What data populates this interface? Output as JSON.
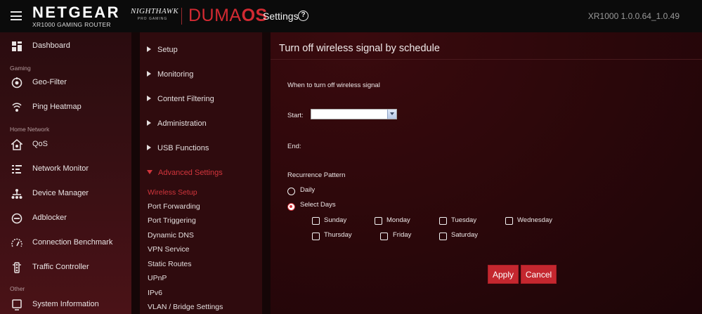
{
  "header": {
    "brand": "NETGEAR",
    "model": "XR1000 GAMING ROUTER",
    "sub_brand": "NIGHTHAWK",
    "sub_brand_tagline": "PRO GAMING",
    "os_prefix": "DUMA",
    "os_suffix": "OS",
    "section_title": "Settings",
    "help_glyph": "?",
    "version": "XR1000 1.0.0.64_1.0.49"
  },
  "sidebar": {
    "sections": {
      "gaming": "Gaming",
      "home_network": "Home Network",
      "other": "Other"
    },
    "items": [
      {
        "label": "Dashboard",
        "icon": "dashboard-icon"
      },
      {
        "label": "Geo-Filter",
        "icon": "geo-filter-icon"
      },
      {
        "label": "Ping Heatmap",
        "icon": "ping-heatmap-icon"
      },
      {
        "label": "QoS",
        "icon": "qos-icon"
      },
      {
        "label": "Network Monitor",
        "icon": "network-monitor-icon"
      },
      {
        "label": "Device Manager",
        "icon": "device-manager-icon"
      },
      {
        "label": "Adblocker",
        "icon": "adblocker-icon"
      },
      {
        "label": "Connection Benchmark",
        "icon": "speedometer-icon"
      },
      {
        "label": "Traffic Controller",
        "icon": "traffic-controller-icon"
      },
      {
        "label": "System Information",
        "icon": "system-information-icon"
      }
    ]
  },
  "subnav": {
    "groups": [
      "Setup",
      "Monitoring",
      "Content Filtering",
      "Administration",
      "USB Functions",
      "Advanced Settings"
    ],
    "advanced_links": [
      "Wireless Setup",
      "Port Forwarding",
      "Port Triggering",
      "Dynamic DNS",
      "VPN Service",
      "Static Routes",
      "UPnP",
      "IPv6",
      "VLAN / Bridge Settings"
    ]
  },
  "main": {
    "title": "Turn off wireless signal by schedule",
    "when_label": "When to turn off wireless signal",
    "start_label": "Start:",
    "start_value": "",
    "end_label": "End:",
    "recurrence_label": "Recurrence Pattern",
    "daily_label": "Daily",
    "select_days_label": "Select Days",
    "days": [
      "Sunday",
      "Monday",
      "Tuesday",
      "Wednesday",
      "Thursday",
      "Friday",
      "Saturday"
    ],
    "apply_label": "Apply",
    "cancel_label": "Cancel"
  },
  "colors": {
    "accent": "#d3353c",
    "button": "#c4272f",
    "topbar": "#0b0b0b"
  }
}
